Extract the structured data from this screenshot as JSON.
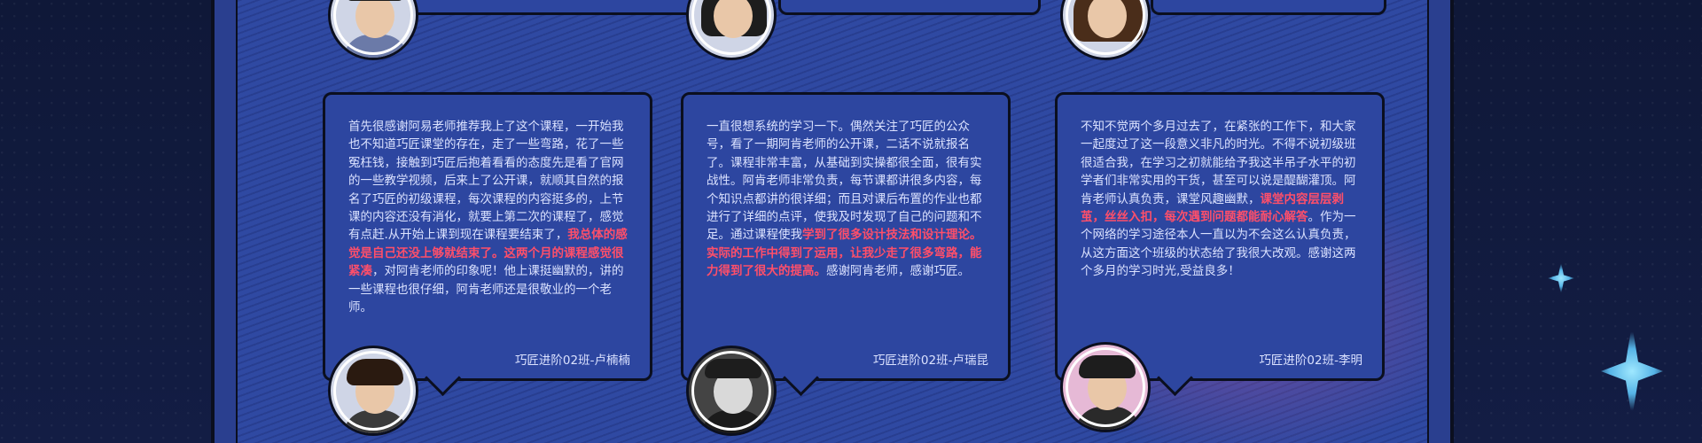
{
  "testimonials": [
    {
      "body_parts": [
        {
          "t": "首先很感谢阿易老师推荐我上了这个课程，一开始我也不知道巧匠课堂的存在，走了一些弯路，花了一些冤枉钱，接触到巧匠后抱着看看的态度先是看了官网的一些教学视频，后来上了公开课，就顺其自然的报名了巧匠的初级课程，每次课程的内容挺多的，上节课的内容还没有消化，就要上第二次的课程了，感觉有点赶.从开始上课到现在课程要结束了，",
          "hl": false
        },
        {
          "t": "我总体的感觉是自己还没上够就结束了。这两个月的课程感觉很紧凑",
          "hl": true
        },
        {
          "t": "，对阿肯老师的印象呢！他上课挺幽默的，讲的一些课程也很仔细，阿肯老师还是很敬业的一个老师。",
          "hl": false
        }
      ],
      "signature": "巧匠进阶02班-卢楠楠"
    },
    {
      "body_parts": [
        {
          "t": "一直很想系统的学习一下。偶然关注了巧匠的公众号，看了一期阿肯老师的公开课，二话不说就报名了。课程非常丰富，从基础到实操都很全面，很有实战性。阿肯老师非常负责，每节课都讲很多内容，每个知识点都讲的很详细；而且对课后布置的作业也都进行了详细的点评，使我及时发现了自己的问题和不足。通过课程使我",
          "hl": false
        },
        {
          "t": "学到了很多设计技法和设计理论。实际的工作中得到了运用，让我少走了很多弯路，能力得到了很大的提高。",
          "hl": true
        },
        {
          "t": "感谢阿肯老师，感谢巧匠。",
          "hl": false
        }
      ],
      "signature": "巧匠进阶02班-卢瑞昆"
    },
    {
      "body_parts": [
        {
          "t": "不知不觉两个多月过去了，在紧张的工作下，和大家一起度过了这一段意义非凡的时光。不得不说初级班很适合我，在学习之初就能给予我这半吊子水平的初学者们非常实用的干货，甚至可以说是醍醐灌顶。阿肯老师认真负责，课堂风趣幽默，",
          "hl": false
        },
        {
          "t": "课堂内容层层剥茧，丝丝入扣，每次遇到问题都能耐心解答",
          "hl": true
        },
        {
          "t": "。作为一个网络的学习途径本人一直以为不会这么认真负责，从这方面这个班级的状态给了我很大改观。感谢这两个多月的学习时光,受益良多！",
          "hl": false
        }
      ],
      "signature": "巧匠进阶02班-李明"
    }
  ],
  "colors": {
    "highlight": "#ff4f6a",
    "card_bg": "#2d46a0",
    "frame_bg": "#2f49a2",
    "page_bg": "#111a3a"
  }
}
